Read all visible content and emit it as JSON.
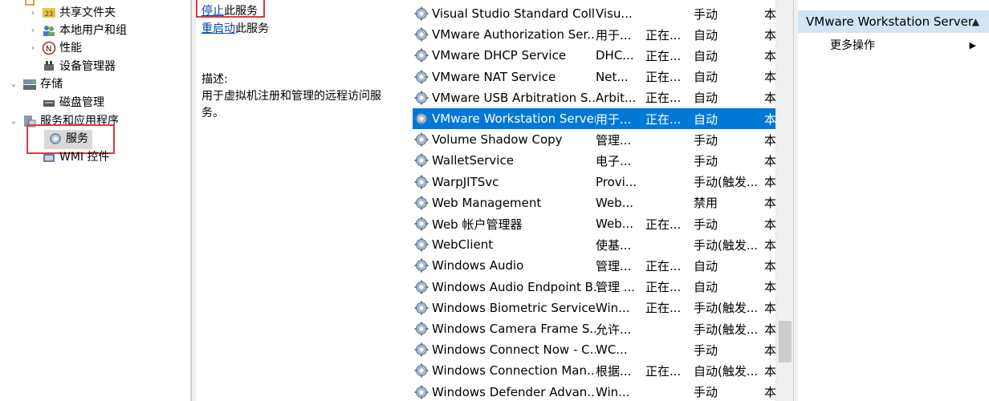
{
  "tree": {
    "items": [
      {
        "label": "共享文件夹",
        "chevron": "›",
        "icon": "shared-folder-icon"
      },
      {
        "label": "本地用户和组",
        "chevron": "›",
        "icon": "users-icon"
      },
      {
        "label": "性能",
        "chevron": "›",
        "icon": "performance-icon"
      },
      {
        "label": "设备管理器",
        "chevron": "",
        "icon": "device-manager-icon"
      },
      {
        "label": "存储",
        "chevron": "⌄",
        "icon": "storage-icon"
      },
      {
        "label": "磁盘管理",
        "chevron": "",
        "icon": "disk-icon"
      },
      {
        "label": "服务和应用程序",
        "chevron": "⌄",
        "icon": "services-apps-icon"
      },
      {
        "label": "服务",
        "chevron": "",
        "icon": "gear-icon"
      },
      {
        "label": "WMI 控件",
        "chevron": "",
        "icon": "wmi-icon"
      }
    ]
  },
  "description": {
    "stop_link": "停止",
    "stop_suffix": "此服务",
    "restart_link": "重启动",
    "restart_suffix": "此服务",
    "heading": "描述:",
    "text": "用于虚拟机注册和管理的远程访问服务。"
  },
  "services": [
    {
      "name": "Visual Studio Standard Coll...",
      "desc": "Visu...",
      "status": "",
      "start": "手动",
      "logon": "本"
    },
    {
      "name": "VMware Authorization Ser...",
      "desc": "用于...",
      "status": "正在...",
      "start": "自动",
      "logon": "本"
    },
    {
      "name": "VMware DHCP Service",
      "desc": "DHC...",
      "status": "正在...",
      "start": "自动",
      "logon": "本"
    },
    {
      "name": "VMware NAT Service",
      "desc": "Net...",
      "status": "正在...",
      "start": "自动",
      "logon": "本"
    },
    {
      "name": "VMware USB Arbitration S...",
      "desc": "Arbit...",
      "status": "正在...",
      "start": "自动",
      "logon": "本"
    },
    {
      "name": "VMware Workstation Server",
      "desc": "用于...",
      "status": "正在...",
      "start": "自动",
      "logon": "本",
      "selected": true
    },
    {
      "name": "Volume Shadow Copy",
      "desc": "管理...",
      "status": "",
      "start": "手动",
      "logon": "本"
    },
    {
      "name": "WalletService",
      "desc": "电子...",
      "status": "",
      "start": "手动",
      "logon": "本"
    },
    {
      "name": "WarpJITSvc",
      "desc": "Provi...",
      "status": "",
      "start": "手动(触发...",
      "logon": "本"
    },
    {
      "name": "Web Management",
      "desc": "Web...",
      "status": "",
      "start": "禁用",
      "logon": "本"
    },
    {
      "name": "Web 帐户管理器",
      "desc": "Web...",
      "status": "正在...",
      "start": "手动",
      "logon": "本"
    },
    {
      "name": "WebClient",
      "desc": "使基...",
      "status": "",
      "start": "手动(触发...",
      "logon": "本"
    },
    {
      "name": "Windows Audio",
      "desc": "管理...",
      "status": "正在...",
      "start": "自动",
      "logon": "本"
    },
    {
      "name": "Windows Audio Endpoint B...",
      "desc": "管理 ...",
      "status": "正在...",
      "start": "自动",
      "logon": "本"
    },
    {
      "name": "Windows Biometric Service",
      "desc": "Win...",
      "status": "正在...",
      "start": "手动(触发...",
      "logon": "本"
    },
    {
      "name": "Windows Camera Frame S...",
      "desc": "允许...",
      "status": "",
      "start": "手动(触发...",
      "logon": "本"
    },
    {
      "name": "Windows Connect Now - C...",
      "desc": "WC...",
      "status": "",
      "start": "手动",
      "logon": "本"
    },
    {
      "name": "Windows Connection Man...",
      "desc": "根据...",
      "status": "正在...",
      "start": "自动(触发...",
      "logon": "本"
    },
    {
      "name": "Windows Defender Advan...",
      "desc": "Win...",
      "status": "",
      "start": "手动",
      "logon": "本"
    }
  ],
  "actions": {
    "header": "VMware Workstation Server",
    "more": "更多操作"
  },
  "colors": {
    "selection": "#0078d7",
    "highlight_box": "#e0393e",
    "link": "#0645ad",
    "actions_header": "#d4e3f5"
  }
}
